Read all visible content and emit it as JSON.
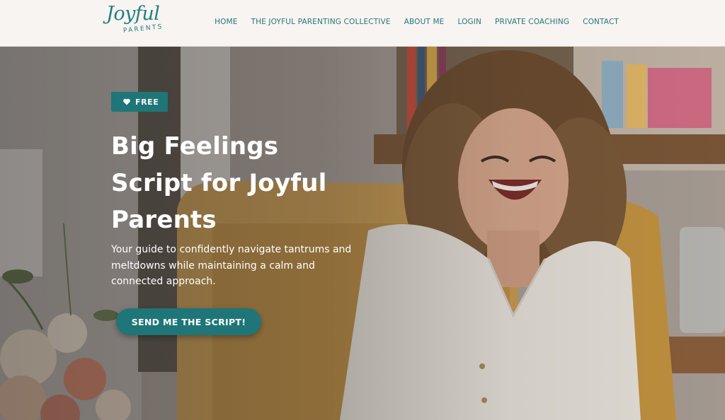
{
  "logo": {
    "script": "Joyful",
    "sub": "PARENTS"
  },
  "nav": {
    "items": [
      {
        "label": "HOME"
      },
      {
        "label": "THE JOYFUL PARENTING COLLECTIVE"
      },
      {
        "label": "ABOUT ME"
      },
      {
        "label": "LOGIN"
      },
      {
        "label": "PRIVATE COACHING"
      },
      {
        "label": "CONTACT"
      }
    ]
  },
  "hero": {
    "badge": {
      "icon": "heart-icon",
      "label": "FREE"
    },
    "title_lines": [
      "Big Feelings",
      "Script for Joyful",
      "Parents"
    ],
    "subtitle": "Your guide to confidently navigate tantrums and meltdowns while maintaining a calm and connected approach.",
    "cta_label": "SEND ME THE SCRIPT!",
    "photo": "smiling-woman-in-armchair"
  },
  "colors": {
    "brand": "#1e7678",
    "header_bg": "#f8f4f2",
    "nav_text": "#24777a",
    "hero_text": "#ffffff"
  }
}
